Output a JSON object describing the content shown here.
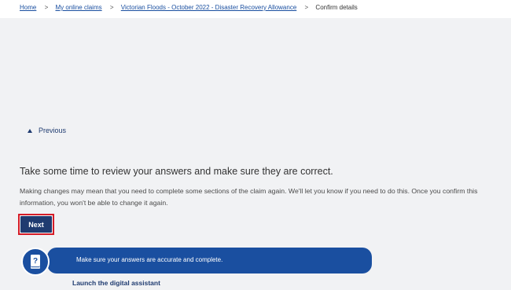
{
  "breadcrumb": {
    "items": [
      {
        "label": "Home"
      },
      {
        "label": "My online claims"
      },
      {
        "label": "Victorian Floods - October 2022 - Disaster Recovery Allowance"
      }
    ],
    "separator": ">",
    "current": "Confirm details"
  },
  "navigation": {
    "previous_label": "Previous"
  },
  "main": {
    "heading": "Take some time to review your answers and make sure they are correct.",
    "body": "Making changes may mean that you need to complete some sections of the claim again. We'll let you know if you need to do this. Once you confirm this information, you won't be able to change it again.",
    "next_label": "Next"
  },
  "assistant": {
    "message": "Make sure your answers are accurate and complete.",
    "launch_label": "Launch the digital assistant",
    "icon": "book-question-icon"
  },
  "colors": {
    "accent": "#1a4fa0",
    "button": "#1f3b70",
    "focus_outline": "#d51c27",
    "page_bg": "#f1f2f4"
  }
}
